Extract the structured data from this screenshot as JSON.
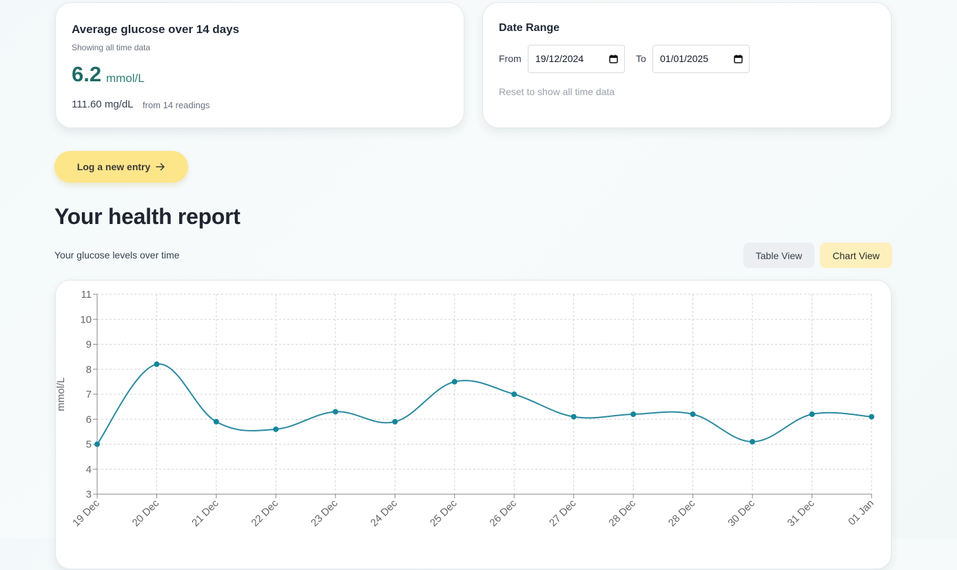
{
  "average_card": {
    "title": "Average glucose over 14 days",
    "subtitle": "Showing all time data",
    "value": "6.2",
    "unit": "mmol/L",
    "mg_value": "111.60 mg/dL",
    "readings": "from 14 readings"
  },
  "date_range": {
    "title": "Date Range",
    "from_label": "From",
    "from_value": "19/12/2024",
    "to_label": "To",
    "to_value": "01/01/2025",
    "reset_label": "Reset to show all time data"
  },
  "log_button": {
    "label": "Log a new entry",
    "icon": "arrow-right-icon"
  },
  "report": {
    "title": "Your health report",
    "subtitle": "Your glucose levels over time",
    "table_view_label": "Table View",
    "chart_view_label": "Chart View",
    "active_view": "Chart View"
  },
  "colors": {
    "accent_teal": "#1f6b66",
    "line": "#2a8aa0",
    "button_yellow": "#fde58a",
    "chart_view_active": "#fdf0bd"
  },
  "chart_data": {
    "type": "line",
    "ylabel": "mmol/L",
    "ylim": [
      3,
      11
    ],
    "yticks": [
      3,
      4,
      5,
      6,
      7,
      8,
      9,
      10,
      11
    ],
    "grid": true,
    "x": [
      "19 Dec",
      "20 Dec",
      "21 Dec",
      "22 Dec",
      "23 Dec",
      "24 Dec",
      "25 Dec",
      "26 Dec",
      "27 Dec",
      "28 Dec",
      "28 Dec",
      "30 Dec",
      "31 Dec",
      "01 Jan"
    ],
    "values": [
      5.0,
      8.2,
      5.9,
      5.6,
      6.3,
      5.9,
      7.5,
      7.0,
      6.1,
      6.2,
      6.2,
      5.1,
      6.2,
      6.1
    ]
  }
}
